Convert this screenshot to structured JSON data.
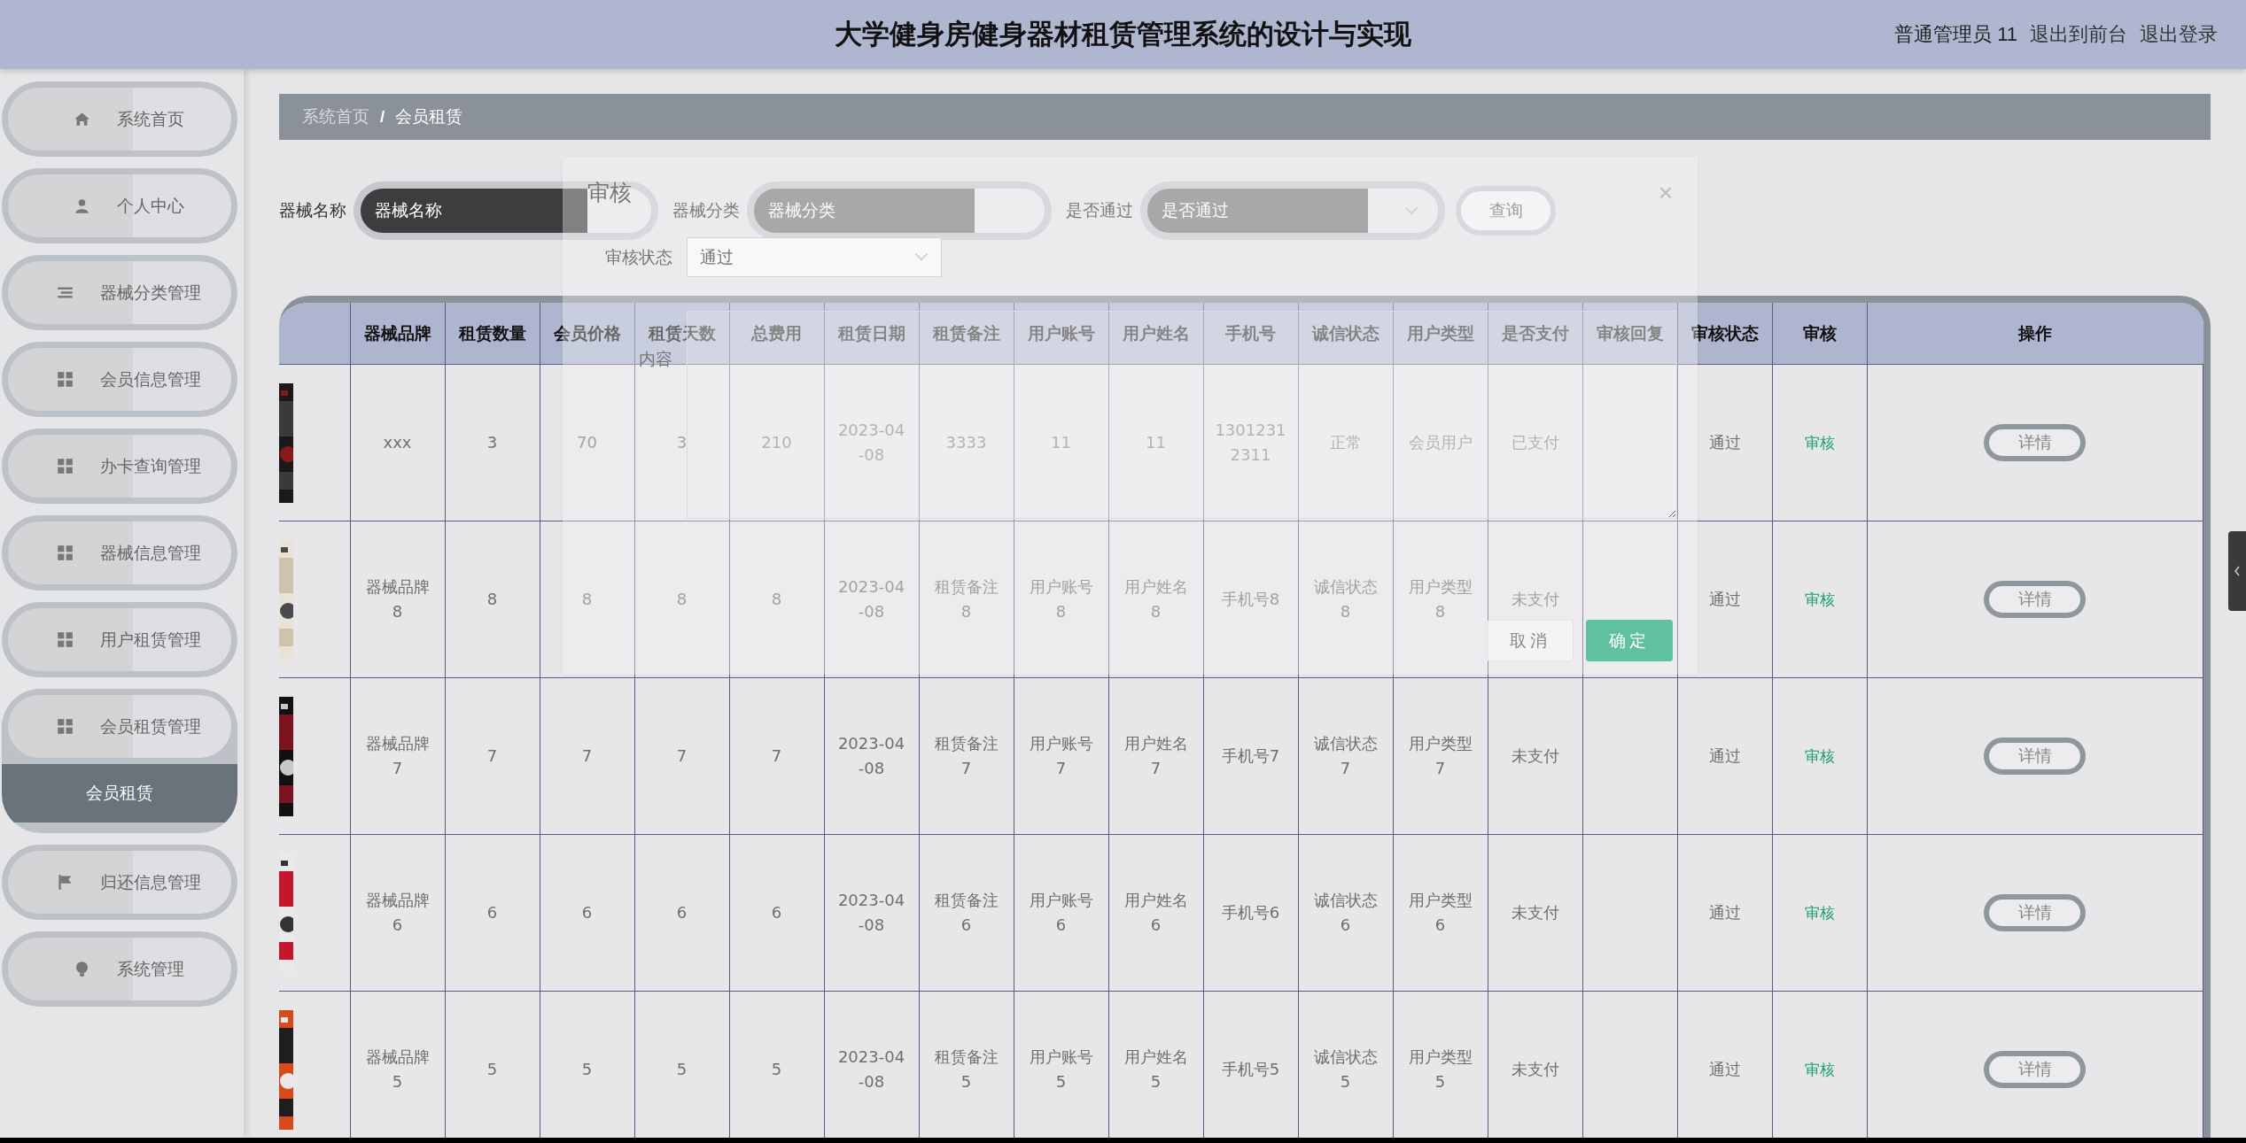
{
  "header": {
    "title": "大学健身房健身器材租赁管理系统的设计与实现",
    "user": "普通管理员 11",
    "links": [
      "退出到前台",
      "退出登录"
    ]
  },
  "sidebar": {
    "items": [
      {
        "label": "系统首页",
        "expanded": false
      },
      {
        "label": "个人中心",
        "expanded": false
      },
      {
        "label": "器械分类管理",
        "expanded": false
      },
      {
        "label": "会员信息管理",
        "expanded": false
      },
      {
        "label": "办卡查询管理",
        "expanded": false
      },
      {
        "label": "器械信息管理",
        "expanded": false
      },
      {
        "label": "用户租赁管理",
        "expanded": false
      },
      {
        "label": "会员租赁管理",
        "expanded": true,
        "children": [
          {
            "label": "会员租赁",
            "selected": true
          }
        ]
      },
      {
        "label": "归还信息管理",
        "expanded": false
      },
      {
        "label": "系统管理",
        "expanded": false
      }
    ]
  },
  "breadcrumb": {
    "items": [
      "系统首页",
      "会员租赁"
    ],
    "separator": "/"
  },
  "filters": [
    {
      "label": "器械名称",
      "kind": "input",
      "placeholder": "器械名称",
      "focused": true
    },
    {
      "label": "器械分类",
      "kind": "input",
      "placeholder": "器械分类",
      "focused": false
    },
    {
      "label": "是否通过",
      "kind": "select",
      "placeholder": "是否通过",
      "focused": false
    }
  ],
  "search_button": "查询",
  "table": {
    "columns": [
      "器械品牌",
      "租赁数量",
      "会员价格",
      "租赁天数",
      "总费用",
      "租赁日期",
      "租赁备注",
      "用户账号",
      "用户姓名",
      "手机号",
      "诚信状态",
      "用户类型",
      "是否支付",
      "审核回复",
      "审核状态",
      "审核",
      "操作"
    ],
    "rows": [
      {
        "cells": [
          "xxx",
          "3",
          "70",
          "3",
          "210",
          "2023-04-08",
          "3333",
          "11",
          "11",
          "13012312311",
          "正常",
          "会员用户",
          "已支付",
          null,
          "通过"
        ],
        "review_link": "审核",
        "button": "详情"
      },
      {
        "cells": [
          "器械品牌8",
          "8",
          "8",
          "8",
          "8",
          "2023-04-08",
          "租赁备注8",
          "用户账号8",
          "用户姓名8",
          "手机号8",
          "诚信状态8",
          "用户类型8",
          "未支付",
          null,
          "通过"
        ],
        "review_link": "审核",
        "button": "详情"
      },
      {
        "cells": [
          "器械品牌7",
          "7",
          "7",
          "7",
          "7",
          "2023-04-08",
          "租赁备注7",
          "用户账号7",
          "用户姓名7",
          "手机号7",
          "诚信状态7",
          "用户类型7",
          "未支付",
          null,
          "通过"
        ],
        "review_link": "审核",
        "button": "详情"
      },
      {
        "cells": [
          "器械品牌6",
          "6",
          "6",
          "6",
          "6",
          "2023-04-08",
          "租赁备注6",
          "用户账号6",
          "用户姓名6",
          "手机号6",
          "诚信状态6",
          "用户类型6",
          "未支付",
          null,
          "通过"
        ],
        "review_link": "审核",
        "button": "详情"
      },
      {
        "cells": [
          "器械品牌5",
          "5",
          "5",
          "5",
          "5",
          "2023-04-08",
          "租赁备注5",
          "用户账号5",
          "用户姓名5",
          "手机号5",
          "诚信状态5",
          "用户类型5",
          "未支付",
          null,
          "通过"
        ],
        "review_link": "审核",
        "button": "详情"
      }
    ]
  },
  "dialog": {
    "title": "审核",
    "close": "×",
    "fields": [
      {
        "label": "审核状态",
        "kind": "select",
        "value": "通过"
      },
      {
        "label": "内容",
        "kind": "textarea"
      }
    ],
    "buttons": [
      {
        "label": "取消",
        "kind": "secondary"
      },
      {
        "label": "确定",
        "kind": "primary"
      }
    ]
  }
}
